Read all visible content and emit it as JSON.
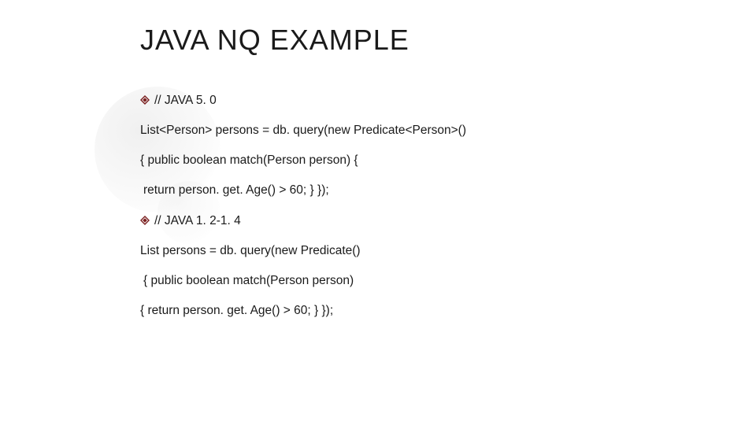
{
  "title": "JAVA NQ EXAMPLE",
  "lines": [
    {
      "bullet": true,
      "text": "// JAVA 5. 0"
    },
    {
      "bullet": false,
      "text": "List<Person> persons = db. query(new Predicate<Person>()"
    },
    {
      "bullet": false,
      "text": "{ public boolean match(Person person) {"
    },
    {
      "bullet": false,
      "text": " return person. get. Age() > 60; } });",
      "indent": true
    },
    {
      "bullet": true,
      "text": "// JAVA 1. 2-1. 4"
    },
    {
      "bullet": false,
      "text": "List persons = db. query(new Predicate()"
    },
    {
      "bullet": false,
      "text": " { public boolean match(Person person)",
      "indent": true
    },
    {
      "bullet": false,
      "text": "{ return person. get. Age() > 60; } });"
    }
  ],
  "colors": {
    "accent": "#7a1f1f"
  }
}
